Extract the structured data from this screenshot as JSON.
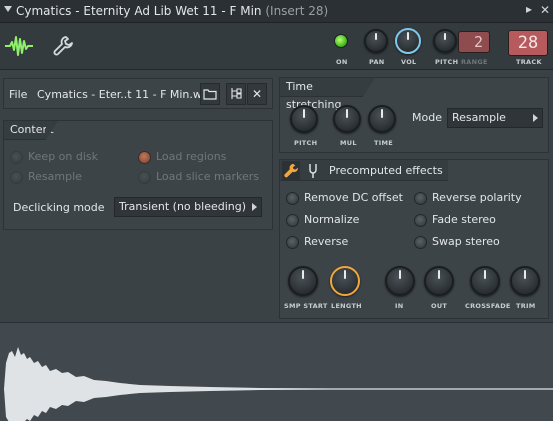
{
  "window": {
    "title": "Cymatics - Eternity Ad Lib Wet 11 - F Min",
    "insert": "(Insert 28)"
  },
  "toolbar": {
    "on_label": "ON",
    "pan_label": "PAN",
    "vol_label": "VOL",
    "pitch_label": "PITCH",
    "range_label": "RANGE",
    "range_value": "2",
    "track_label": "TRACK",
    "track_value": "28",
    "colors": {
      "led": "#4bbd1e",
      "vol_ring": "#7fc8ea",
      "range_bg": "#8f4c4e",
      "track_bg": "#b75a5e"
    }
  },
  "file": {
    "label": "File",
    "name": "Cymatics - Eter..t 11 - F Min.wav",
    "icons": [
      "folder-icon",
      "file-tree-icon",
      "close-icon"
    ]
  },
  "content": {
    "title": "Content",
    "options": [
      {
        "label": "Keep on disk",
        "enabled": false
      },
      {
        "label": "Load regions",
        "enabled": false,
        "checked": true
      },
      {
        "label": "Resample",
        "enabled": false
      },
      {
        "label": "Load slice markers",
        "enabled": false
      }
    ],
    "declicking_label": "Declicking mode",
    "declicking_value": "Transient (no bleeding)"
  },
  "time_stretching": {
    "title": "Time stretching",
    "knobs": [
      "PITCH",
      "MUL",
      "TIME"
    ],
    "mode_label": "Mode",
    "mode_value": "Resample"
  },
  "precomputed": {
    "title": "Precomputed effects",
    "options": [
      {
        "label": "Remove DC offset"
      },
      {
        "label": "Reverse polarity"
      },
      {
        "label": "Normalize"
      },
      {
        "label": "Fade stereo"
      },
      {
        "label": "Reverse"
      },
      {
        "label": "Swap stereo"
      }
    ],
    "knobs": [
      "SMP START",
      "LENGTH",
      "IN",
      "OUT",
      "CROSSFADE",
      "TRIM"
    ]
  }
}
